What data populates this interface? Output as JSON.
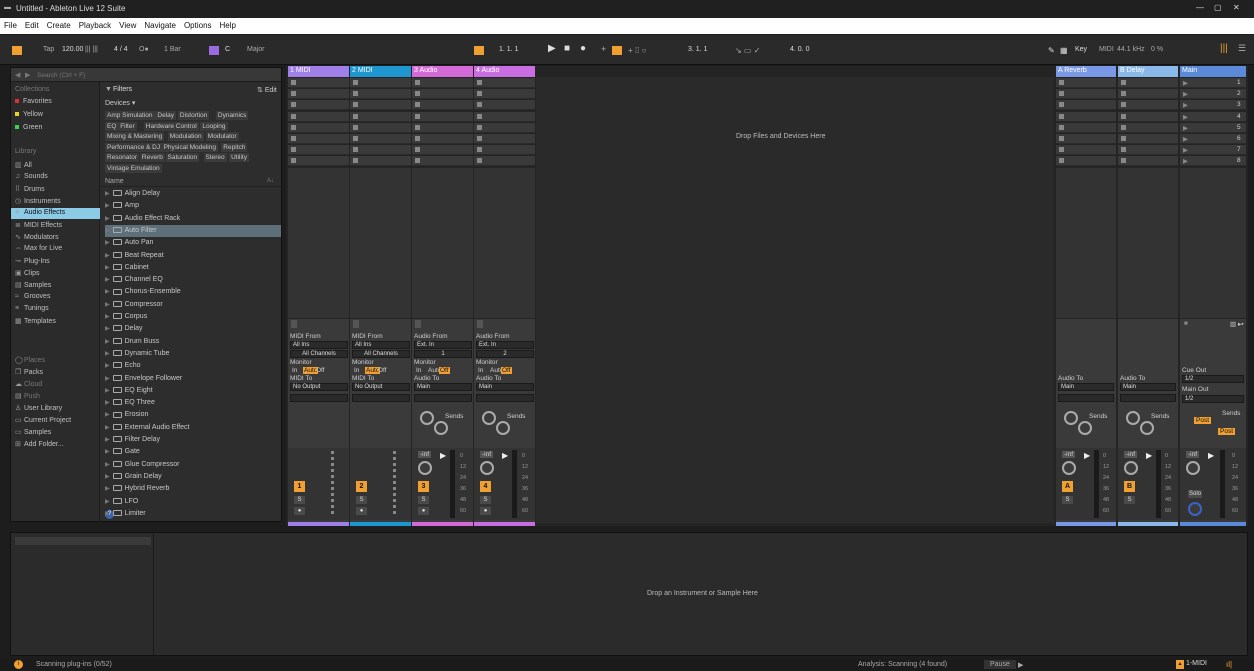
{
  "window": {
    "title": "Untitled - Ableton Live 12 Suite",
    "min": "—",
    "max": "▢",
    "close": "✕"
  },
  "menu": [
    "File",
    "Edit",
    "Create",
    "Playback",
    "View",
    "Navigate",
    "Options",
    "Help"
  ],
  "toolbar": {
    "tap": "Tap",
    "tempo": "120.00",
    "nudge": "||| |||",
    "signature": "4 / 4",
    "metro": "O●",
    "quant": "1 Bar",
    "key": "C",
    "scale": "Major",
    "position": "1.  1.  1",
    "loop_start": "3.  1.  1",
    "loop_len": "4.  0.  0",
    "key_label": "Key",
    "midi_label": "MIDI",
    "sample_rate": "44.1 kHz",
    "cpu": "0 %"
  },
  "browser": {
    "search_placeholder": "Search (Ctrl + F)",
    "collections_label": "Collections",
    "collections": [
      {
        "label": "Favorites",
        "color": "#e0302a"
      },
      {
        "label": "Yellow",
        "color": "#e8d22a"
      },
      {
        "label": "Green",
        "color": "#3ed14a"
      }
    ],
    "library_label": "Library",
    "library": [
      {
        "icon": "grid-icon",
        "glyph": "▥",
        "label": "All"
      },
      {
        "icon": "note-icon",
        "glyph": "♫",
        "label": "Sounds"
      },
      {
        "icon": "drum-icon",
        "glyph": "⠿",
        "label": "Drums"
      },
      {
        "icon": "clock-icon",
        "glyph": "◷",
        "label": "Instruments"
      },
      {
        "icon": "audio-fx-icon",
        "glyph": "⟡",
        "label": "Audio Effects"
      },
      {
        "icon": "midi-fx-icon",
        "glyph": "≣",
        "label": "MIDI Effects"
      },
      {
        "icon": "wave-icon",
        "glyph": "∿",
        "label": "Modulators"
      },
      {
        "icon": "max-icon",
        "glyph": "⇔",
        "label": "Max for Live"
      },
      {
        "icon": "plugin-icon",
        "glyph": "⊸",
        "label": "Plug-Ins"
      },
      {
        "icon": "clip-icon",
        "glyph": "▣",
        "label": "Clips"
      },
      {
        "icon": "sample-icon",
        "glyph": "▤",
        "label": "Samples"
      },
      {
        "icon": "groove-icon",
        "glyph": "≈",
        "label": "Grooves"
      },
      {
        "icon": "tuning-icon",
        "glyph": "≡",
        "label": "Tunings"
      },
      {
        "icon": "template-icon",
        "glyph": "▦",
        "label": "Templates"
      }
    ],
    "places": [
      {
        "icon": "places-icon",
        "glyph": "◯",
        "label": "Places"
      },
      {
        "icon": "packs-icon",
        "glyph": "❐",
        "label": "Packs"
      },
      {
        "icon": "cloud-icon",
        "glyph": "☁",
        "label": "Cloud"
      },
      {
        "icon": "push-icon",
        "glyph": "▤",
        "label": "Push"
      },
      {
        "icon": "user-icon",
        "glyph": "♙",
        "label": "User Library"
      },
      {
        "icon": "project-icon",
        "glyph": "▭",
        "label": "Current Project"
      },
      {
        "icon": "samples-folder-icon",
        "glyph": "▭",
        "label": "Samples"
      },
      {
        "icon": "add-folder-icon",
        "glyph": "⊞",
        "label": "Add Folder..."
      }
    ],
    "filters_label": "Filters",
    "edit_label": "Edit",
    "devices_label": "Devices ▾",
    "tag_rows": [
      [
        "Amp Simulation",
        "Delay",
        "Distortion",
        "Dynamics"
      ],
      [
        "EQ",
        "Filter",
        "Hardware Control",
        "Looping"
      ],
      [
        "Mixing & Mastering",
        "Modulation",
        "Modulator"
      ],
      [
        "Performance & DJ",
        "Physical Modeling",
        "Repitch"
      ],
      [
        "Resonator",
        "Reverb",
        "Saturation",
        "Stereo",
        "Utility"
      ],
      [
        "Vintage Emulation"
      ]
    ],
    "name_header": "Name",
    "sort_icon": "A↓",
    "items": [
      "Align Delay",
      "Amp",
      "Audio Effect Rack",
      "Auto Filter",
      "Auto Pan",
      "Beat Repeat",
      "Cabinet",
      "Channel EQ",
      "Chorus-Ensemble",
      "Compressor",
      "Corpus",
      "Delay",
      "Drum Buss",
      "Dynamic Tube",
      "Echo",
      "Envelope Follower",
      "EQ Eight",
      "EQ Three",
      "Erosion",
      "External Audio Effect",
      "Filter Delay",
      "Gate",
      "Glue Compressor",
      "Grain Delay",
      "Hybrid Reverb",
      "LFO",
      "Limiter"
    ],
    "selected_item": "Auto Filter"
  },
  "session": {
    "drop_text": "Drop Files and Devices Here",
    "tracks": [
      {
        "name": "1 MIDI",
        "color": "#a080e8",
        "num": "1",
        "type": "midi",
        "from_label": "MIDI From",
        "from": "All Ins",
        "channel": "All Channels",
        "to_label": "MIDI To",
        "to": "No Output"
      },
      {
        "name": "2 MIDI",
        "color": "#1e96d0",
        "num": "2",
        "type": "midi",
        "from_label": "MIDI From",
        "from": "All Ins",
        "channel": "All Channels",
        "to_label": "MIDI To",
        "to": "No Output"
      },
      {
        "name": "3 Audio",
        "color": "#d46ad8",
        "num": "3",
        "type": "audio",
        "from_label": "Audio From",
        "from": "Ext. In",
        "channel": "1",
        "to_label": "Audio To",
        "to": "Main"
      },
      {
        "name": "4 Audio",
        "color": "#c86ee0",
        "num": "4",
        "type": "audio",
        "from_label": "Audio From",
        "from": "Ext. In",
        "channel": "2",
        "to_label": "Audio To",
        "to": "Main"
      }
    ],
    "returns": [
      {
        "name": "A Reverb",
        "color": "#7a98e8",
        "num": "A",
        "to": "Main"
      },
      {
        "name": "B Delay",
        "color": "#8ab8e8",
        "num": "B",
        "to": "Main"
      }
    ],
    "main": {
      "name": "Main",
      "color": "#5a8ad8",
      "scenes": [
        "1",
        "2",
        "3",
        "4",
        "5",
        "6",
        "7",
        "8"
      ],
      "cue_label": "Cue Out",
      "cue": "1/2",
      "main_out_label": "Main Out",
      "main_out": "1/2",
      "solo": "Solo"
    },
    "monitor_label": "Monitor",
    "monitor_opts": [
      "In",
      "Auto",
      "Off"
    ],
    "sends_label": "Sends",
    "audio_to_label": "Audio To",
    "post_label": "Post",
    "vol_label": "-inf",
    "scale": [
      "0",
      "12",
      "24",
      "36",
      "48",
      "60"
    ],
    "knob_a": "A",
    "knob_b": "B",
    "solo_label": "S"
  },
  "detail": {
    "drop_text": "Drop an Instrument or Sample Here"
  },
  "status": {
    "scanning": "Scanning plug-ins (0/52)",
    "analysis": "Analysis: Scanning (4 found)",
    "pause": "Pause",
    "track": "1-MIDI"
  }
}
